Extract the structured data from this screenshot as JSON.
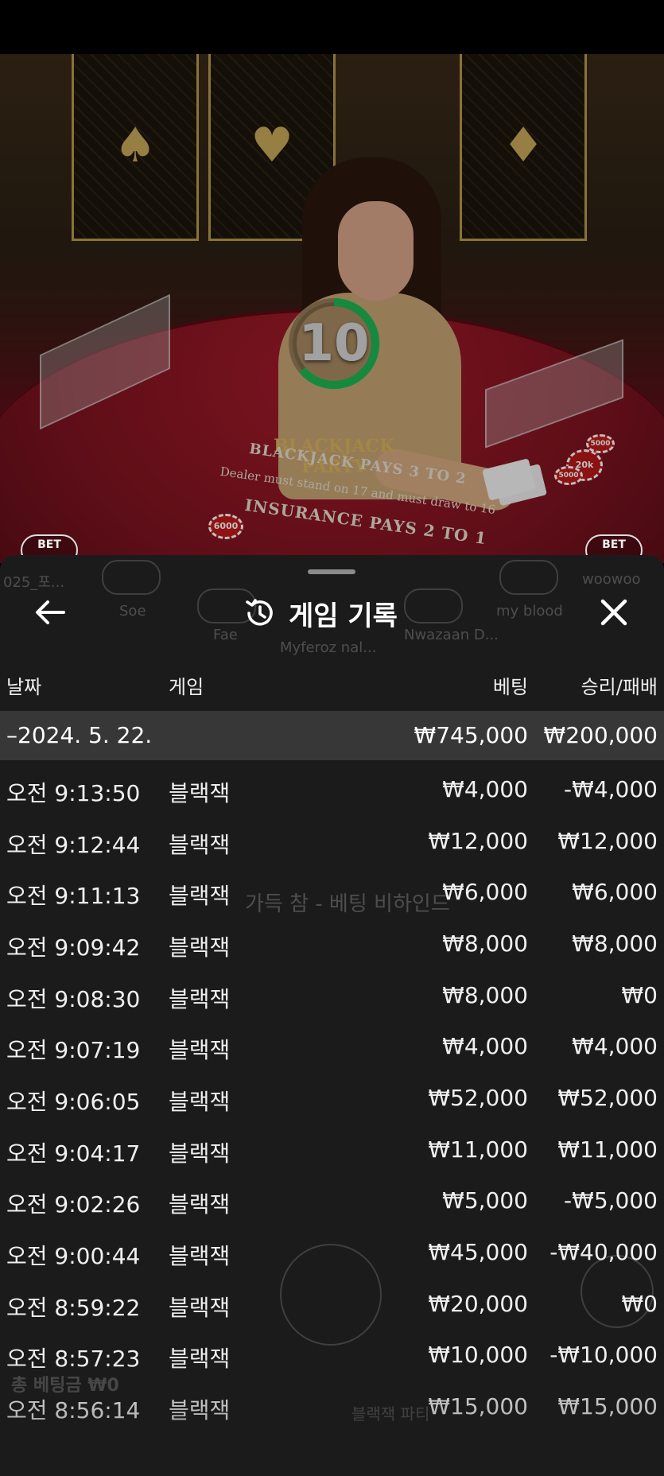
{
  "video": {
    "timer_value": "10",
    "table_logo": "BLACKJACK PARTY",
    "table_text_line1": "BLACKJACK PAYS 3 TO 2",
    "table_text_line2": "Dealer must stand on 17 and must draw to 16",
    "table_text_line3": "INSURANCE PAYS 2 TO 1",
    "chip_labels": [
      "6000",
      "20k",
      "5000",
      "5000"
    ],
    "bet_pill_left": "BET",
    "bet_pill_right": "BET"
  },
  "background_ghost": {
    "seats": [
      "025_포...",
      "Soe",
      "Fae",
      "Myferoz nal...",
      "Nwazaan D...",
      "my blood",
      "woowoo"
    ],
    "middle_message": "가득 참 - 베팅 비하인드",
    "bottom_left": "총 베팅금  ₩0",
    "bottom_right": "블랙잭 파티"
  },
  "sheet": {
    "title": "게임 기록",
    "history_icon": "history-icon",
    "back_icon": "arrow-left-icon",
    "close_icon": "close-icon"
  },
  "table": {
    "headers": {
      "date": "날짜",
      "game": "게임",
      "bet": "베팅",
      "result": "승리/패배"
    },
    "summary": {
      "date": "–2024. 5. 22.",
      "bet": "₩745,000",
      "result": "₩200,000"
    },
    "rows": [
      {
        "time": "오전 9:13:50",
        "game": "블랙잭",
        "bet": "₩4,000",
        "result": "-₩4,000"
      },
      {
        "time": "오전 9:12:44",
        "game": "블랙잭",
        "bet": "₩12,000",
        "result": "₩12,000"
      },
      {
        "time": "오전 9:11:13",
        "game": "블랙잭",
        "bet": "₩6,000",
        "result": "₩6,000"
      },
      {
        "time": "오전 9:09:42",
        "game": "블랙잭",
        "bet": "₩8,000",
        "result": "₩8,000"
      },
      {
        "time": "오전 9:08:30",
        "game": "블랙잭",
        "bet": "₩8,000",
        "result": "₩0"
      },
      {
        "time": "오전 9:07:19",
        "game": "블랙잭",
        "bet": "₩4,000",
        "result": "₩4,000"
      },
      {
        "time": "오전 9:06:05",
        "game": "블랙잭",
        "bet": "₩52,000",
        "result": "₩52,000"
      },
      {
        "time": "오전 9:04:17",
        "game": "블랙잭",
        "bet": "₩11,000",
        "result": "₩11,000"
      },
      {
        "time": "오전 9:02:26",
        "game": "블랙잭",
        "bet": "₩5,000",
        "result": "-₩5,000"
      },
      {
        "time": "오전 9:00:44",
        "game": "블랙잭",
        "bet": "₩45,000",
        "result": "-₩40,000"
      },
      {
        "time": "오전 8:59:22",
        "game": "블랙잭",
        "bet": "₩20,000",
        "result": "₩0"
      },
      {
        "time": "오전 8:57:23",
        "game": "블랙잭",
        "bet": "₩10,000",
        "result": "-₩10,000"
      },
      {
        "time": "오전 8:56:14",
        "game": "블랙잭",
        "bet": "₩15,000",
        "result": "₩15,000"
      }
    ]
  },
  "colors": {
    "sheet_bg": "#1b1b1b",
    "summary_bg": "#373737",
    "timer_ring": "#1db954",
    "felt": "#7d1320"
  }
}
